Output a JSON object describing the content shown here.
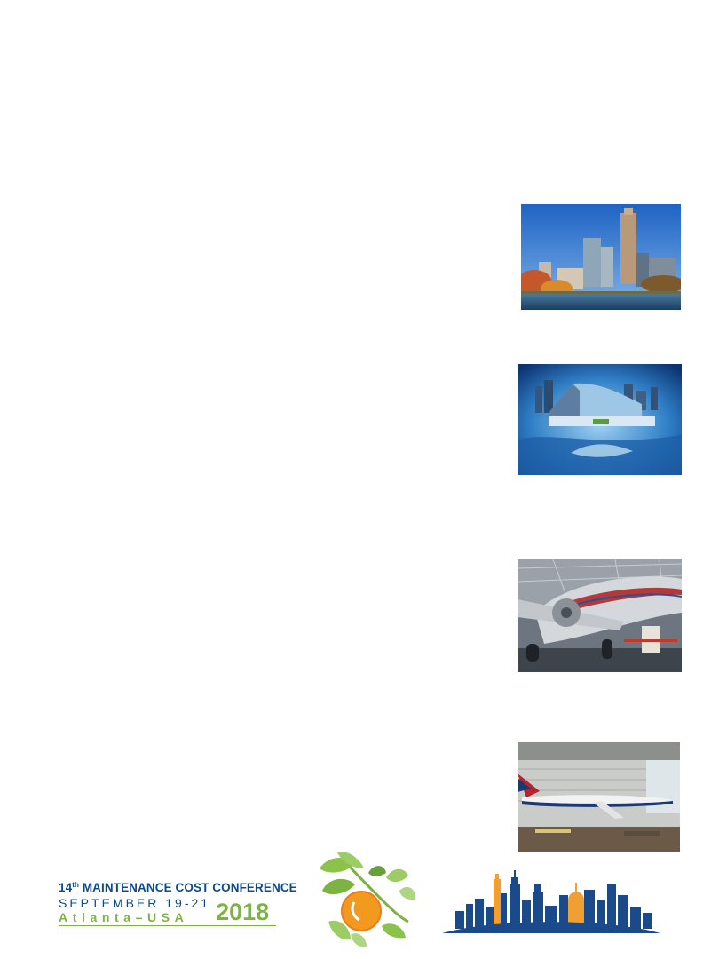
{
  "photos": [
    {
      "name": "midtown-skyline-photo"
    },
    {
      "name": "aquarium-photo"
    },
    {
      "name": "vintage-airplane-photo"
    },
    {
      "name": "hangar-airliner-photo"
    }
  ],
  "footer": {
    "conference_title_prefix": "14",
    "conference_title_ordinal": "th",
    "conference_title_rest": " MAINTENANCE COST CONFERENCE",
    "dates": "SEPTEMBER 19-21",
    "location": "Atlanta–USA",
    "year": "2018"
  },
  "colors": {
    "brand_blue": "#0b4a8f",
    "brand_green": "#7cb342",
    "peach_orange": "#f39a1e",
    "skyline_orange": "#f0a033"
  }
}
